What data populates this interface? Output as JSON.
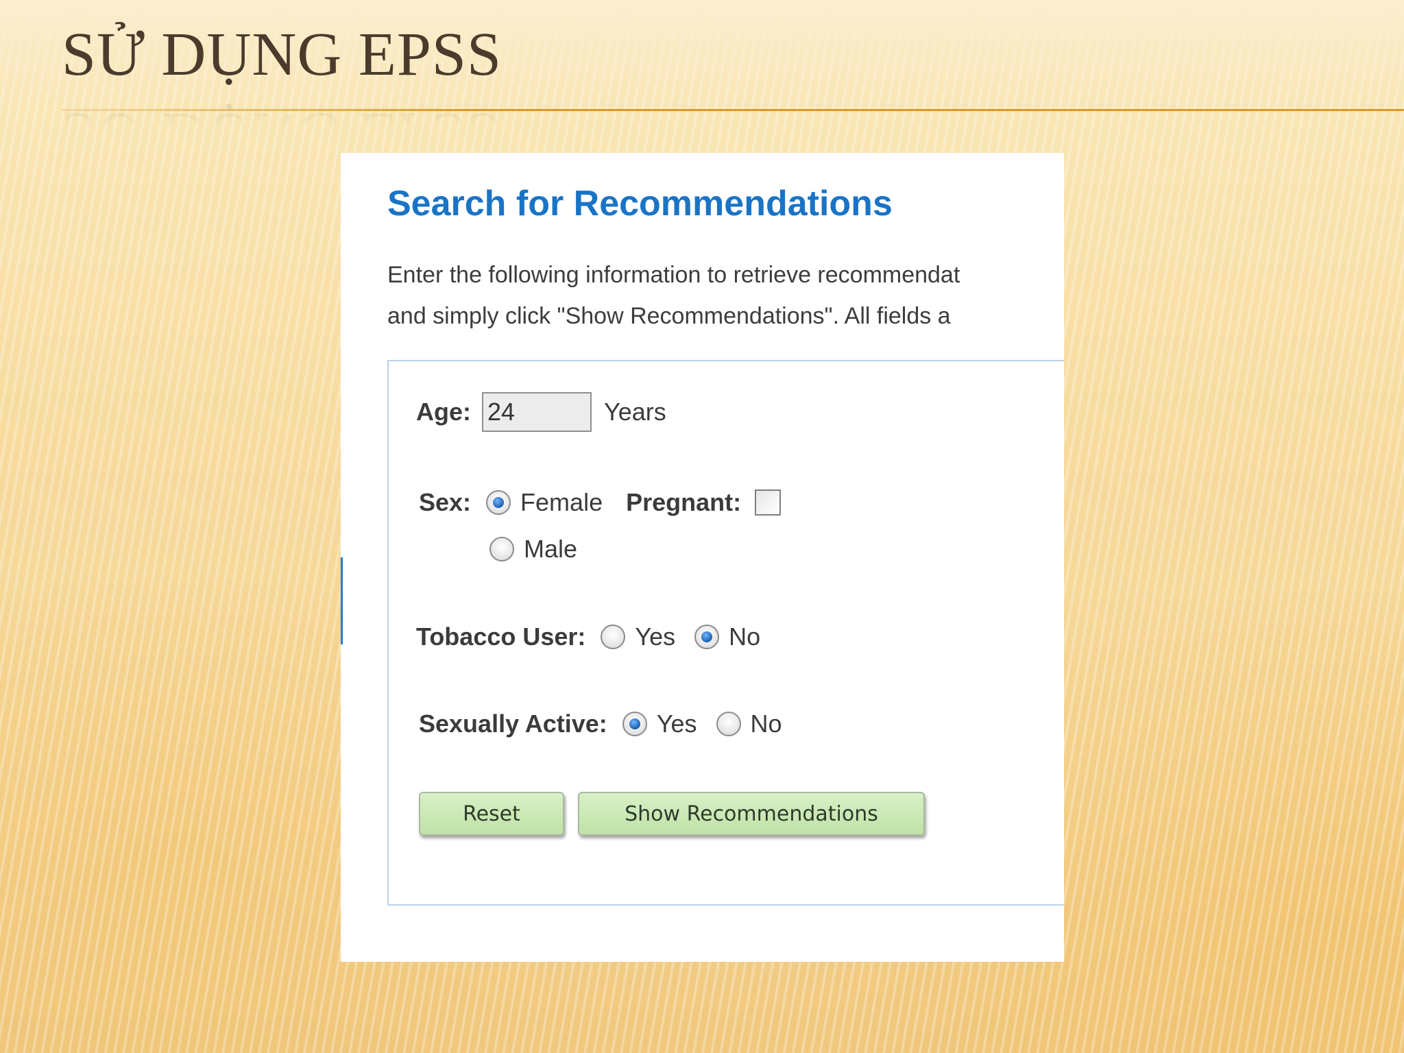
{
  "slide": {
    "title": "SỬ DỤNG EPSS"
  },
  "form": {
    "heading": "Search for Recommendations",
    "intro_line1": "Enter the following information to retrieve recommendat",
    "intro_line2": "and simply click \"Show Recommendations\". All fields a",
    "age": {
      "label": "Age:",
      "value": "24",
      "unit": "Years"
    },
    "sex": {
      "label": "Sex:",
      "options": [
        "Female",
        "Male"
      ],
      "selected": "Female",
      "pregnant_label": "Pregnant:",
      "pregnant_checked": false
    },
    "tobacco": {
      "label": "Tobacco User:",
      "options": [
        "Yes",
        "No"
      ],
      "selected": "No"
    },
    "sexually_active": {
      "label": "Sexually Active:",
      "options": [
        "Yes",
        "No"
      ],
      "selected": "Yes"
    },
    "buttons": {
      "reset": "Reset",
      "show": "Show Recommendations"
    }
  },
  "colors": {
    "heading": "#1a74c5",
    "title_text": "#4a3b2c",
    "title_rule": "#d99a2b",
    "button_green": "#c9e8b3",
    "panel_border": "#b9d2e8"
  }
}
